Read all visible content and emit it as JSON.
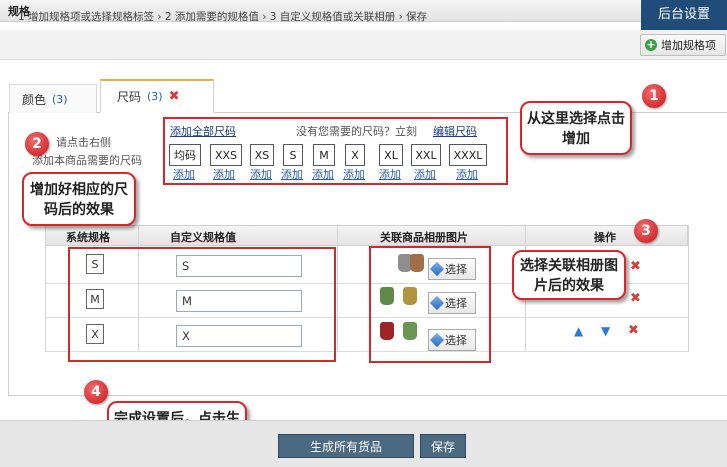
{
  "header": {
    "title": "规格",
    "admin_settings": "后台设置"
  },
  "steps": {
    "text": "1 增加规格项或选择规格标签  ›  2 添加需要的规格值  ›  3 自定义规格值或关联相册  ›  保存",
    "add_spec_label": "增加规格项"
  },
  "tabs": [
    {
      "label": "颜色",
      "count": "(3)"
    },
    {
      "label": "尺码",
      "count": "(3)",
      "close": "✖"
    }
  ],
  "hint": {
    "line1": "请点击右侧",
    "line2": "添加本商品需要的尺码"
  },
  "size_picker": {
    "add_all": "添加全部尺码",
    "no_size": "没有您需要的尺码？立刻",
    "edit_size": "编辑尺码",
    "chips": [
      "均码",
      "XXS",
      "XS",
      "S",
      "M",
      "X",
      "XL",
      "XXL",
      "XXXL"
    ],
    "add_label": "添加"
  },
  "table": {
    "headers": [
      "系统规格",
      "自定义规格值",
      "关联商品相册图片",
      "操作"
    ],
    "rows": [
      {
        "tag": "S",
        "value": "S",
        "choose": "选择"
      },
      {
        "tag": "M",
        "value": "M",
        "choose": "选择"
      },
      {
        "tag": "X",
        "value": "X",
        "choose": "选择"
      }
    ],
    "ops": {
      "up": "▲",
      "down": "▼",
      "del": "✖"
    }
  },
  "annotations": {
    "n1": "1",
    "c1": "从这里选择点击增加",
    "n2": "2",
    "c2": "增加好相应的尺码后的效果",
    "n3": "3",
    "c3": "选择关联相册图片后的效果",
    "n4": "4",
    "c4": "完成设置后，点击生成所有货品"
  },
  "footer": {
    "generate": "生成所有货品",
    "save": "保存"
  },
  "colors": {
    "annotation_red": "#d8262b",
    "admin_bg": "#1f4c79",
    "button_bg": "#4b6a82",
    "link_blue": "#1a3c8a"
  }
}
